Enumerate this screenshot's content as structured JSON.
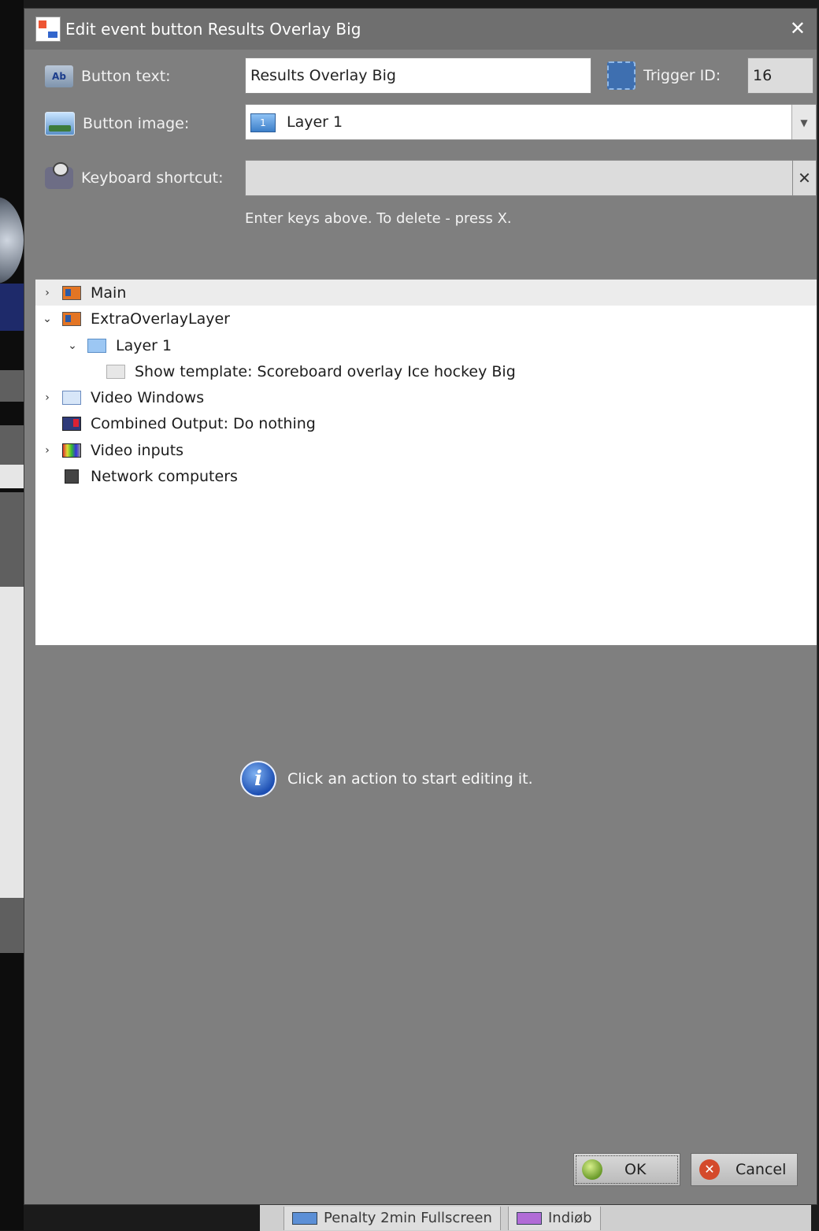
{
  "dialog": {
    "title": "Edit event button Results Overlay Big",
    "close_glyph": "✕"
  },
  "form": {
    "button_text_label": "Button text:",
    "button_text_value": "Results Overlay Big",
    "trigger_id_label": "Trigger ID:",
    "trigger_id_value": "16",
    "button_image_label": "Button image:",
    "button_image_value": "Layer 1",
    "button_image_icon_text": "1",
    "keyboard_shortcut_label": "Keyboard shortcut:",
    "keyboard_shortcut_value": "",
    "clear_glyph": "✕",
    "hint": "Enter keys above. To delete - press X."
  },
  "tree": {
    "rows": [
      {
        "label": "Main",
        "chevron": "›",
        "icon": "layer-icon"
      },
      {
        "label": "ExtraOverlayLayer",
        "chevron": "⌄",
        "icon": "layer-icon"
      },
      {
        "label": "Layer 1",
        "chevron": "⌄",
        "icon": "monitor-layer-icon"
      },
      {
        "label": "Show template: Scoreboard overlay  Ice hockey Big",
        "chevron": "",
        "icon": "template-icon"
      },
      {
        "label": "Video Windows",
        "chevron": "›",
        "icon": "window-icon"
      },
      {
        "label": "Combined Output: Do nothing",
        "chevron": "",
        "icon": "output-icon"
      },
      {
        "label": "Video inputs",
        "chevron": "›",
        "icon": "video-input-icon"
      },
      {
        "label": "Network computers",
        "chevron": "",
        "icon": "network-icon"
      }
    ]
  },
  "info": {
    "text": "Click an action to start editing it.",
    "icon_glyph": "i"
  },
  "buttons": {
    "ok": "OK",
    "cancel": "Cancel",
    "cancel_glyph": "✕"
  },
  "background": {
    "btn1": "Penalty 2min Fullscreen",
    "btn2": "Indiøb"
  }
}
